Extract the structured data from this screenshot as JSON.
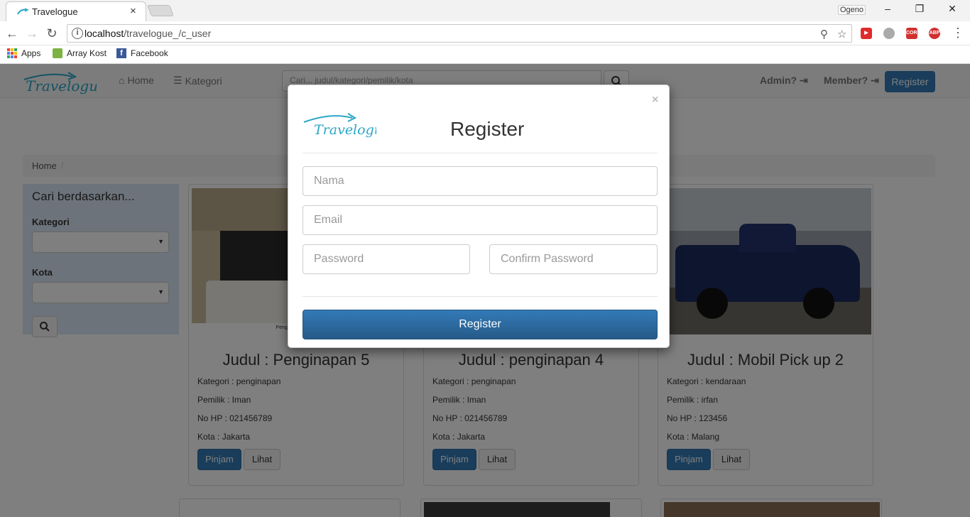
{
  "browser": {
    "tab_title": "Travelogue",
    "tab_close": "×",
    "profile": "Ogeno",
    "window_controls": {
      "minimize": "–",
      "restore": "❐",
      "close": "✕"
    },
    "url_host": "localhost",
    "url_path": "/travelogue_/c_user",
    "bookmarks": [
      "Apps",
      "Array Kost",
      "Facebook"
    ]
  },
  "navbar": {
    "brand": "Travelogue",
    "home": "Home",
    "kategori": "Kategori",
    "search_placeholder": "Cari... judul/kategori/pemilik/kota",
    "admin": "Admin?",
    "member": "Member?",
    "register": "Register"
  },
  "breadcrumb": {
    "home": "Home",
    "separator": "/"
  },
  "sidebar": {
    "heading": "Cari berdasarkan...",
    "kategori_label": "Kategori",
    "kota_label": "Kota"
  },
  "cards": [
    {
      "title": "Judul : Penginapan 5",
      "kategori": "Kategori : penginapan",
      "pemilik": "Pemilik : Iman",
      "hp": "No HP : 021456789",
      "kota": "Kota : Jakarta",
      "pinjam": "Pinjam",
      "lihat": "Lihat",
      "caption": "Penginapan Murah"
    },
    {
      "title": "Judul : penginapan 4",
      "kategori": "Kategori : penginapan",
      "pemilik": "Pemilik : Iman",
      "hp": "No HP : 021456789",
      "kota": "Kota : Jakarta",
      "pinjam": "Pinjam",
      "lihat": "Lihat"
    },
    {
      "title": "Judul : Mobil Pick up 2",
      "kategori": "Kategori : kendaraan",
      "pemilik": "Pemilik : irfan",
      "hp": "No HP : 123456",
      "kota": "Kota : Malang",
      "pinjam": "Pinjam",
      "lihat": "Lihat"
    }
  ],
  "modal": {
    "title": "Register",
    "close": "×",
    "nama_placeholder": "Nama",
    "email_placeholder": "Email",
    "password_placeholder": "Password",
    "confirm_placeholder": "Confirm Password",
    "submit": "Register"
  },
  "colors": {
    "primary": "#337ab7",
    "brand": "#2aa7c7",
    "sidebar_bg": "#dbe6f5"
  }
}
